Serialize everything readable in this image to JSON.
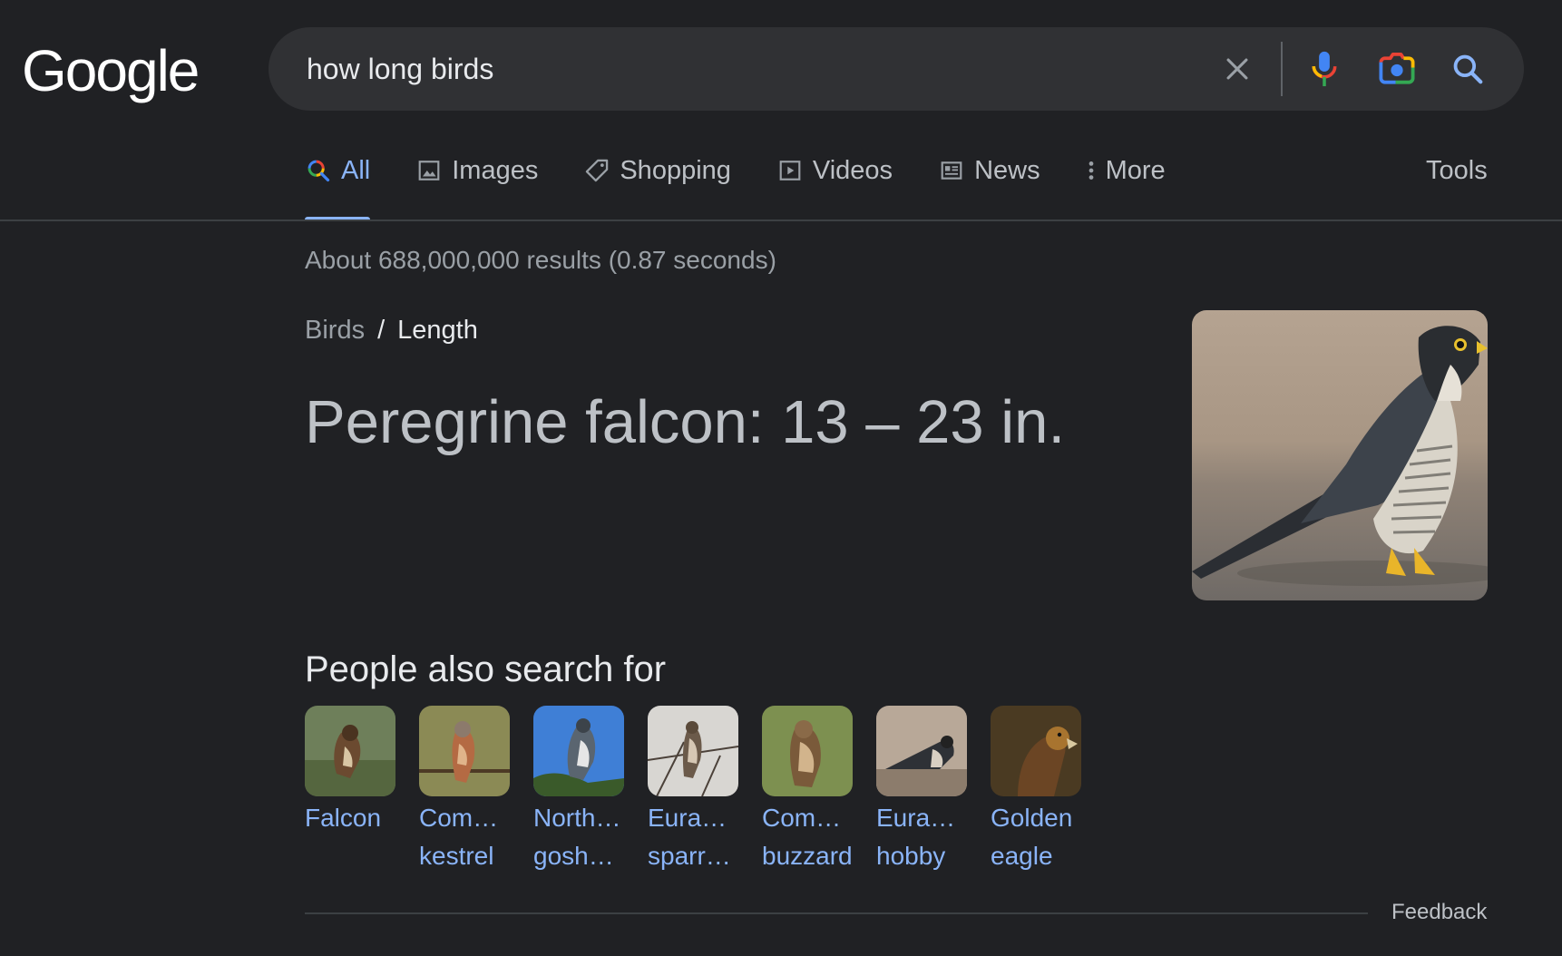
{
  "header": {
    "logo_text": "Google",
    "search_value": "how long birds"
  },
  "tabs": [
    {
      "label": "All",
      "icon": "search-multicolor-icon",
      "active": true
    },
    {
      "label": "Images",
      "icon": "image-icon"
    },
    {
      "label": "Shopping",
      "icon": "tag-icon"
    },
    {
      "label": "Videos",
      "icon": "play-icon"
    },
    {
      "label": "News",
      "icon": "newspaper-icon"
    },
    {
      "label": "More",
      "icon": "kebab-icon"
    }
  ],
  "tools_label": "Tools",
  "stats": "About 688,000,000 results (0.87 seconds)",
  "breadcrumb": {
    "parent": "Birds",
    "separator": "/",
    "current": "Length"
  },
  "answer": "Peregrine falcon: 13 – 23 in.",
  "people_also_search": {
    "title": "People also search for",
    "items": [
      {
        "line1": "Falcon",
        "line2": ""
      },
      {
        "line1": "Com…",
        "line2": "kestrel"
      },
      {
        "line1": "North…",
        "line2": "gosh…"
      },
      {
        "line1": "Eura…",
        "line2": "sparr…"
      },
      {
        "line1": "Com…",
        "line2": "buzzard"
      },
      {
        "line1": "Eura…",
        "line2": "hobby"
      },
      {
        "line1": "Golden",
        "line2": "eagle"
      }
    ]
  },
  "feedback_label": "Feedback",
  "colors": {
    "background": "#202124",
    "link": "#8ab4f8",
    "searchbar": "#303134"
  }
}
